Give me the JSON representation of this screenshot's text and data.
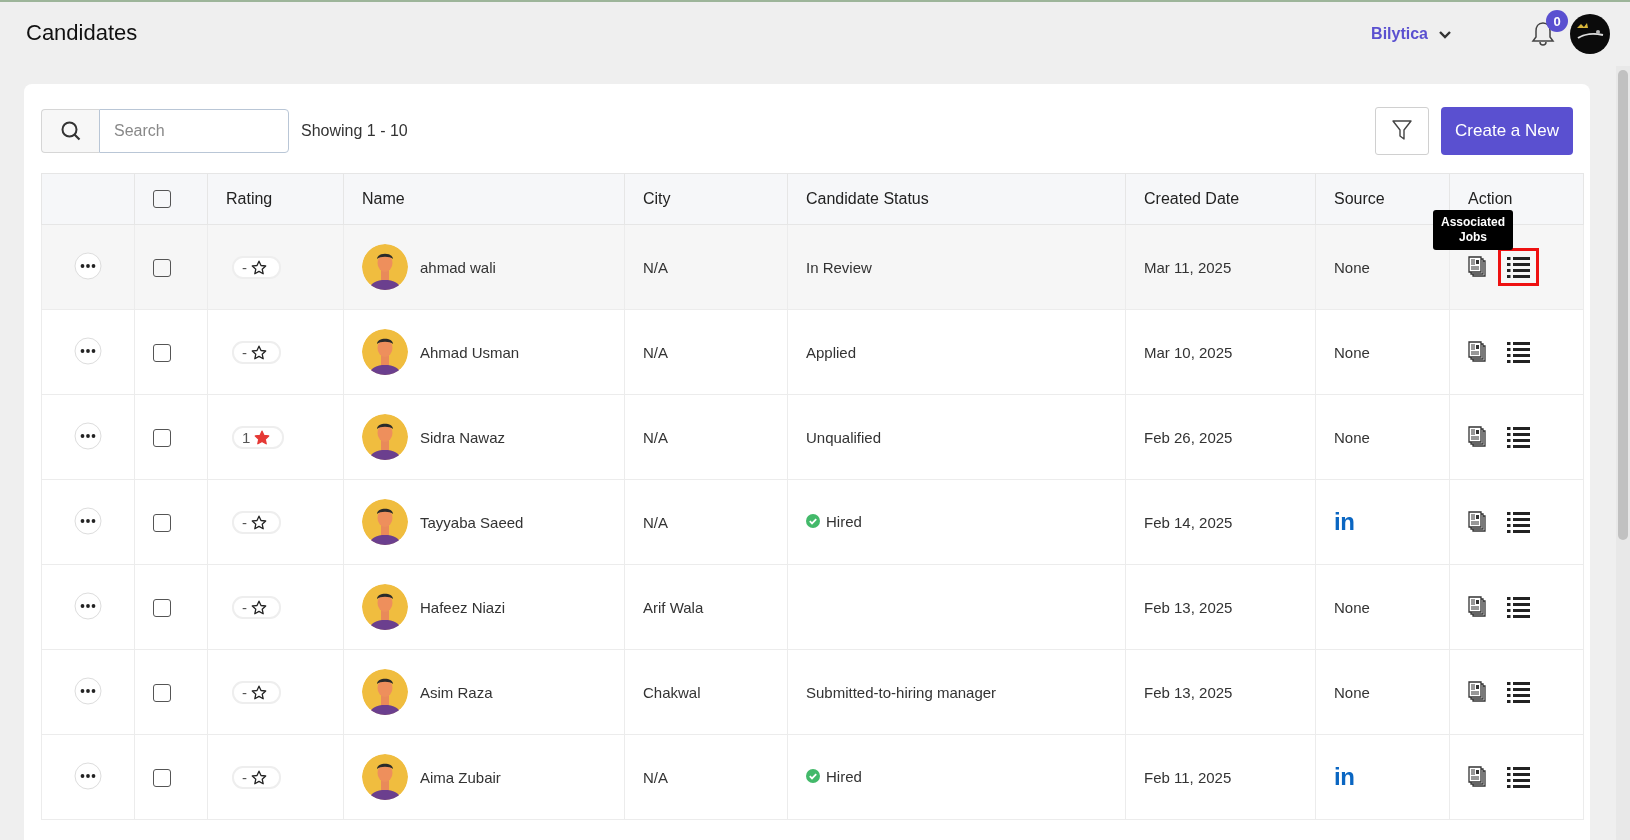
{
  "page_title": "Candidates",
  "header": {
    "company": "Bilytica",
    "notifications": "0"
  },
  "toolbar": {
    "search_placeholder": "Search",
    "showing": "Showing 1 - 10",
    "create_button": "Create a New"
  },
  "table": {
    "columns": [
      "",
      "",
      "Rating",
      "Name",
      "City",
      "Candidate Status",
      "Created Date",
      "Source",
      "Action"
    ],
    "header_checked": false,
    "tooltip": "Associated Jobs",
    "rows": [
      {
        "checked": false,
        "rating": "-",
        "starred": false,
        "name": "ahmad wali",
        "city": "N/A",
        "status": {
          "kind": "plain",
          "text": "In Review"
        },
        "created": "Mar 11, 2025",
        "source": {
          "kind": "text",
          "text": "None"
        },
        "hovered": true
      },
      {
        "checked": false,
        "rating": "-",
        "starred": false,
        "name": "Ahmad Usman",
        "city": "N/A",
        "status": {
          "kind": "plain",
          "text": "Applied"
        },
        "created": "Mar 10, 2025",
        "source": {
          "kind": "text",
          "text": "None"
        },
        "hovered": false
      },
      {
        "checked": false,
        "rating": "1",
        "starred": true,
        "name": "Sidra Nawaz",
        "city": "N/A",
        "status": {
          "kind": "plain",
          "text": "Unqualified"
        },
        "created": "Feb 26, 2025",
        "source": {
          "kind": "text",
          "text": "None"
        },
        "hovered": false
      },
      {
        "checked": false,
        "rating": "-",
        "starred": false,
        "name": "Tayyaba Saeed",
        "city": "N/A",
        "status": {
          "kind": "hired",
          "text": "Hired"
        },
        "created": "Feb 14, 2025",
        "source": {
          "kind": "linkedin",
          "text": "in"
        },
        "hovered": false
      },
      {
        "checked": false,
        "rating": "-",
        "starred": false,
        "name": "Hafeez Niazi",
        "city": "Arif Wala",
        "created": "Feb 13, 2025",
        "source": {
          "kind": "text",
          "text": "None"
        },
        "hovered": false
      },
      {
        "checked": false,
        "rating": "-",
        "starred": false,
        "name": "Asim Raza",
        "city": "Chakwal",
        "status": {
          "kind": "plain",
          "text": "Submitted-to-hiring manager"
        },
        "created": "Feb 13, 2025",
        "source": {
          "kind": "text",
          "text": "None"
        },
        "hovered": false
      },
      {
        "checked": false,
        "rating": "-",
        "starred": false,
        "name": "Aima Zubair",
        "city": "N/A",
        "status": {
          "kind": "hired",
          "text": "Hired"
        },
        "created": "Feb 11, 2025",
        "source": {
          "kind": "linkedin",
          "text": "in"
        },
        "hovered": false
      }
    ]
  }
}
